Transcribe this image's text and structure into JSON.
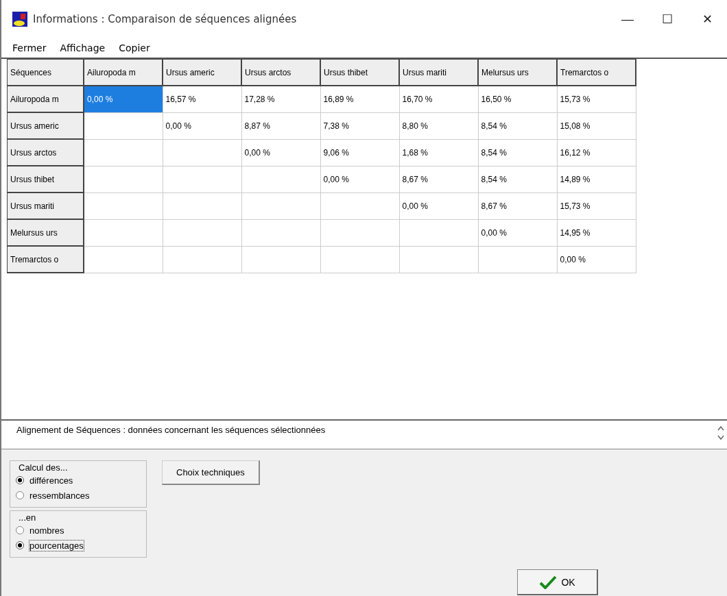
{
  "window": {
    "title": "Informations : Comparaison de séquences alignées",
    "controls": [
      "—",
      "☐",
      "✕"
    ]
  },
  "menu": [
    "Fermer",
    "Affichage",
    "Copier"
  ],
  "table": {
    "corner": "Séquences",
    "columns": [
      "Ailuropoda m",
      "Ursus americ",
      "Ursus arctos",
      "Ursus thibet",
      "Ursus mariti",
      "Melursus urs",
      "Tremarctos o"
    ],
    "rows": [
      {
        "name": "Ailuropoda m",
        "cells": [
          {
            "text": "0,00 %",
            "selected": true
          },
          {
            "text": "16,57 %",
            "selected": false
          },
          {
            "text": "17,28 %",
            "selected": false
          },
          {
            "text": "16,89 %",
            "selected": false
          },
          {
            "text": "16,70 %",
            "selected": false
          },
          {
            "text": "16,50 %",
            "selected": false
          },
          {
            "text": "15,73 %",
            "selected": false
          }
        ]
      },
      {
        "name": "Ursus americ",
        "cells": [
          null,
          {
            "text": "0,00 %",
            "selected": false
          },
          {
            "text": "8,87 %",
            "selected": false
          },
          {
            "text": "7,38 %",
            "selected": false
          },
          {
            "text": "8,80 %",
            "selected": false
          },
          {
            "text": "8,54 %",
            "selected": false
          },
          {
            "text": "15,08 %",
            "selected": false
          }
        ]
      },
      {
        "name": "Ursus arctos",
        "cells": [
          null,
          null,
          {
            "text": "0,00 %",
            "selected": false
          },
          {
            "text": "9,06 %",
            "selected": false
          },
          {
            "text": "1,68 %",
            "selected": false
          },
          {
            "text": "8,54 %",
            "selected": false
          },
          {
            "text": "16,12 %",
            "selected": false
          }
        ]
      },
      {
        "name": "Ursus thibet",
        "cells": [
          null,
          null,
          null,
          {
            "text": "0,00 %",
            "selected": false
          },
          {
            "text": "8,67 %",
            "selected": false
          },
          {
            "text": "8,54 %",
            "selected": false
          },
          {
            "text": "14,89 %",
            "selected": false
          }
        ]
      },
      {
        "name": "Ursus mariti",
        "cells": [
          null,
          null,
          null,
          null,
          {
            "text": "0,00 %",
            "selected": false
          },
          {
            "text": "8,67 %",
            "selected": false
          },
          {
            "text": "15,73 %",
            "selected": false
          }
        ]
      },
      {
        "name": "Melursus urs",
        "cells": [
          null,
          null,
          null,
          null,
          null,
          {
            "text": "0,00 %",
            "selected": false
          },
          {
            "text": "14,95 %",
            "selected": false
          }
        ]
      },
      {
        "name": "Tremarctos o",
        "cells": [
          null,
          null,
          null,
          null,
          null,
          null,
          {
            "text": "0,00 %",
            "selected": false
          }
        ]
      }
    ]
  },
  "info_box": {
    "text": "Alignement de Séquences : données concernant les séquences sélectionnées"
  },
  "groups": [
    {
      "title": "Calcul des...",
      "options": [
        {
          "label": "différences",
          "selected": true
        },
        {
          "label": "ressemblances",
          "selected": false
        }
      ]
    },
    {
      "title": "...en",
      "options": [
        {
          "label": "nombres",
          "selected": false
        },
        {
          "label": "pourcentages",
          "selected": true
        }
      ]
    }
  ],
  "buttons": {
    "techniques": "Choix techniques",
    "ok": "OK"
  }
}
